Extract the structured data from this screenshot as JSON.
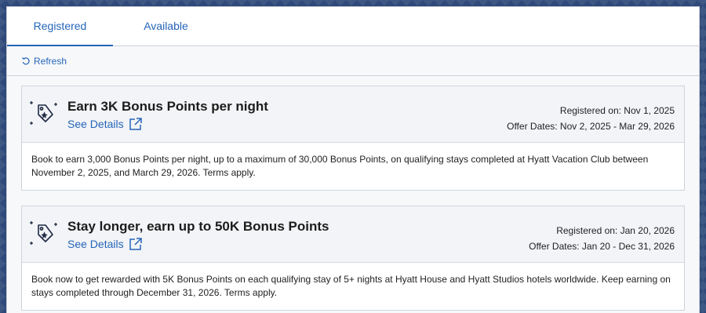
{
  "tabs": [
    {
      "label": "Registered",
      "active": true
    },
    {
      "label": "Available",
      "active": false
    }
  ],
  "toolbar": {
    "refresh_label": "Refresh",
    "refresh_icon": "refresh-icon"
  },
  "colors": {
    "accent": "#2565b8",
    "text": "#222222",
    "header_bg": "#f2f4f7"
  },
  "offers": [
    {
      "title": "Earn 3K Bonus Points per night",
      "see_details": "See Details",
      "registered_on": "Registered on: Nov 1, 2025",
      "offer_dates": "Offer Dates: Nov 2, 2025 - Mar 29, 2026",
      "description": "Book to earn 3,000 Bonus Points per night, up to a maximum of 30,000 Bonus Points, on qualifying stays completed at Hyatt Vacation Club between November 2, 2025, and March 29, 2026. Terms apply."
    },
    {
      "title": "Stay longer, earn up to 50K Bonus Points",
      "see_details": "See Details",
      "registered_on": "Registered on: Jan 20, 2026",
      "offer_dates": "Offer Dates: Jan 20 - Dec 31, 2026",
      "description": "Book now to get rewarded with 5K Bonus Points on each qualifying stay of 5+ nights at Hyatt House and Hyatt Studios hotels worldwide. Keep earning on stays completed through December 31, 2026. Terms apply."
    }
  ]
}
